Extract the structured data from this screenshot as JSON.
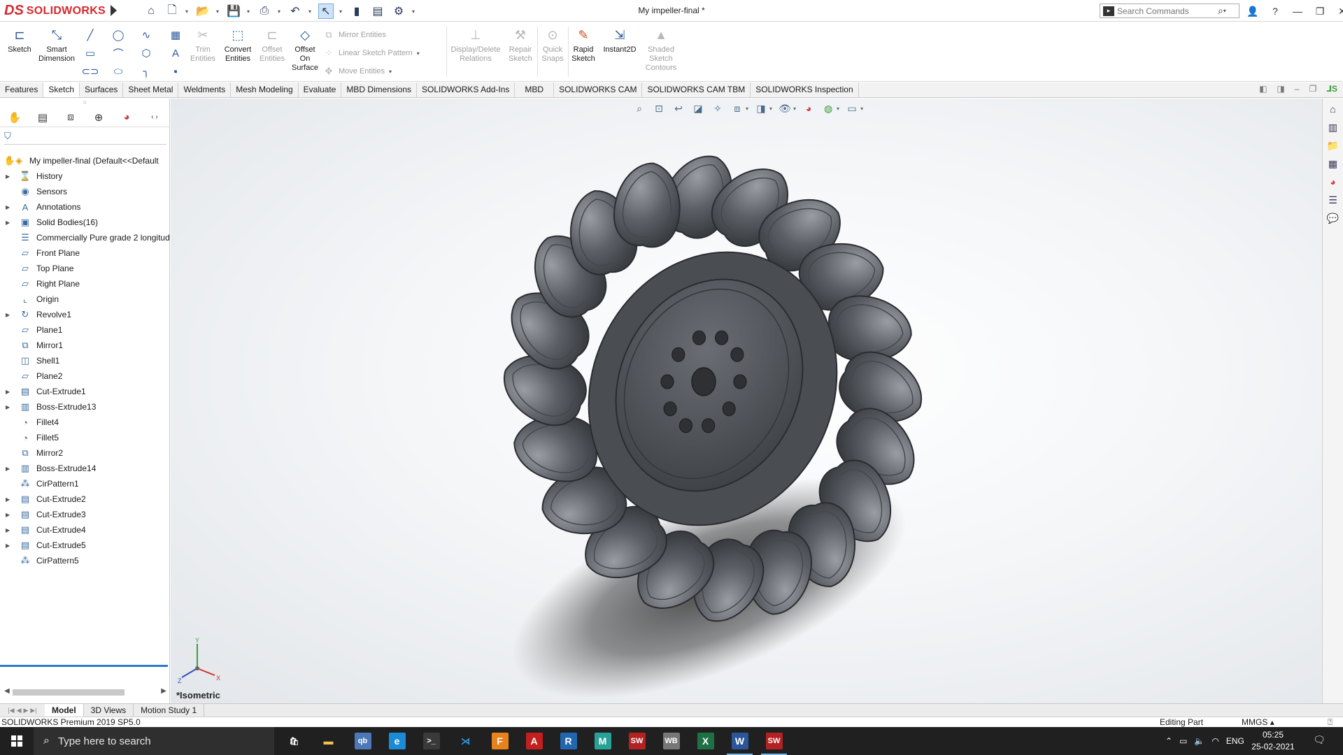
{
  "app": {
    "logo_ds": "DS",
    "logo_text": "SOLIDWORKS",
    "document_title": "My impeller-final *",
    "search_placeholder": "Search Commands"
  },
  "ribbon": {
    "sketch": "Sketch",
    "smart_dimension": "Smart Dimension",
    "trim_entities": "Trim Entities",
    "convert_entities": "Convert Entities",
    "offset_entities": "Offset Entities",
    "offset_on_surface": "Offset On Surface",
    "mirror_entities": "Mirror Entities",
    "linear_sketch_pattern": "Linear Sketch Pattern",
    "move_entities": "Move Entities",
    "display_delete_relations": "Display/Delete Relations",
    "repair_sketch": "Repair Sketch",
    "quick_snaps": "Quick Snaps",
    "rapid_sketch": "Rapid Sketch",
    "instant2d": "Instant2D",
    "shaded_sketch_contours": "Shaded Sketch Contours"
  },
  "tabs": [
    "Features",
    "Sketch",
    "Surfaces",
    "Sheet Metal",
    "Weldments",
    "Mesh Modeling",
    "Evaluate",
    "MBD Dimensions",
    "SOLIDWORKS Add-Ins",
    "MBD",
    "SOLIDWORKS CAM",
    "SOLIDWORKS CAM TBM",
    "SOLIDWORKS Inspection"
  ],
  "active_tab": "Sketch",
  "tree": {
    "root": "My impeller-final  (Default<<Default",
    "items": [
      {
        "label": "History",
        "expand": true,
        "icon": "history-icon",
        "glyph": "⌛"
      },
      {
        "label": "Sensors",
        "expand": false,
        "icon": "sensor-icon",
        "glyph": "◉"
      },
      {
        "label": "Annotations",
        "expand": true,
        "icon": "annotation-icon",
        "glyph": "A"
      },
      {
        "label": "Solid Bodies(16)",
        "expand": true,
        "icon": "solid-body-icon",
        "glyph": "▣"
      },
      {
        "label": "Commercially Pure grade 2 longitud",
        "expand": false,
        "icon": "material-icon",
        "glyph": "☰"
      },
      {
        "label": "Front Plane",
        "expand": false,
        "icon": "plane-icon",
        "glyph": "▱"
      },
      {
        "label": "Top Plane",
        "expand": false,
        "icon": "plane-icon",
        "glyph": "▱"
      },
      {
        "label": "Right Plane",
        "expand": false,
        "icon": "plane-icon",
        "glyph": "▱"
      },
      {
        "label": "Origin",
        "expand": false,
        "icon": "origin-icon",
        "glyph": "⌞"
      },
      {
        "label": "Revolve1",
        "expand": true,
        "icon": "revolve-icon",
        "glyph": "↻"
      },
      {
        "label": "Plane1",
        "expand": false,
        "icon": "plane-icon",
        "glyph": "▱"
      },
      {
        "label": "Mirror1",
        "expand": false,
        "icon": "mirror-icon",
        "glyph": "⧉"
      },
      {
        "label": "Shell1",
        "expand": false,
        "icon": "shell-icon",
        "glyph": "◫"
      },
      {
        "label": "Plane2",
        "expand": false,
        "icon": "plane-icon",
        "glyph": "▱"
      },
      {
        "label": "Cut-Extrude1",
        "expand": true,
        "icon": "cut-extrude-icon",
        "glyph": "▤"
      },
      {
        "label": "Boss-Extrude13",
        "expand": true,
        "icon": "boss-extrude-icon",
        "glyph": "▥"
      },
      {
        "label": "Fillet4",
        "expand": false,
        "icon": "fillet-icon",
        "glyph": "◔"
      },
      {
        "label": "Fillet5",
        "expand": false,
        "icon": "fillet-icon",
        "glyph": "◔"
      },
      {
        "label": "Mirror2",
        "expand": false,
        "icon": "mirror-icon",
        "glyph": "⧉"
      },
      {
        "label": "Boss-Extrude14",
        "expand": true,
        "icon": "boss-extrude-icon",
        "glyph": "▥"
      },
      {
        "label": "CirPattern1",
        "expand": false,
        "icon": "circular-pattern-icon",
        "glyph": "⁂"
      },
      {
        "label": "Cut-Extrude2",
        "expand": true,
        "icon": "cut-extrude-icon",
        "glyph": "▤"
      },
      {
        "label": "Cut-Extrude3",
        "expand": true,
        "icon": "cut-extrude-icon",
        "glyph": "▤"
      },
      {
        "label": "Cut-Extrude4",
        "expand": true,
        "icon": "cut-extrude-icon",
        "glyph": "▤"
      },
      {
        "label": "Cut-Extrude5",
        "expand": true,
        "icon": "cut-extrude-icon",
        "glyph": "▤"
      },
      {
        "label": "CirPattern5",
        "expand": false,
        "icon": "circular-pattern-icon",
        "glyph": "⁂"
      }
    ]
  },
  "viewport": {
    "view_name": "*Isometric",
    "triad": {
      "x": "X",
      "y": "Y",
      "z": "Z"
    }
  },
  "bottom_tabs": [
    "Model",
    "3D Views",
    "Motion Study 1"
  ],
  "active_bottom_tab": "Model",
  "status": {
    "version": "SOLIDWORKS Premium 2019 SP5.0",
    "mode": "Editing Part",
    "units": "MMGS"
  },
  "taskbar": {
    "search_placeholder": "Type here to search",
    "apps": [
      {
        "name": "store",
        "glyph": "🛍",
        "bg": "#202020",
        "fg": "#ffffff"
      },
      {
        "name": "file-explorer",
        "glyph": "▬",
        "bg": "#202020",
        "fg": "#f2c14e"
      },
      {
        "name": "qbittorrent",
        "glyph": "qb",
        "bg": "#4a78b8",
        "fg": "#ffffff"
      },
      {
        "name": "edge",
        "glyph": "e",
        "bg": "#1c8bd6",
        "fg": "#ffffff"
      },
      {
        "name": "terminal",
        "glyph": ">_",
        "bg": "#3a3a3a",
        "fg": "#ffffff"
      },
      {
        "name": "vscode",
        "glyph": "⋊",
        "bg": "#202020",
        "fg": "#2a9ae8"
      },
      {
        "name": "app-f",
        "glyph": "F",
        "bg": "#e8821c",
        "fg": "#ffffff"
      },
      {
        "name": "acrobat",
        "glyph": "A",
        "bg": "#c41e1e",
        "fg": "#ffffff"
      },
      {
        "name": "r-app",
        "glyph": "R",
        "bg": "#2166b0",
        "fg": "#ffffff"
      },
      {
        "name": "m-app",
        "glyph": "M",
        "bg": "#2aa198",
        "fg": "#ffffff"
      },
      {
        "name": "solidworks-2019-a",
        "glyph": "SW",
        "bg": "#b22222",
        "fg": "#ffffff"
      },
      {
        "name": "wb-app",
        "glyph": "WB",
        "bg": "#777777",
        "fg": "#ffffff"
      },
      {
        "name": "excel",
        "glyph": "X",
        "bg": "#1e7145",
        "fg": "#ffffff"
      },
      {
        "name": "word",
        "glyph": "W",
        "bg": "#2b579a",
        "fg": "#ffffff"
      },
      {
        "name": "solidworks-2019-b",
        "glyph": "SW",
        "bg": "#b22222",
        "fg": "#ffffff"
      }
    ],
    "active_apps": [
      "word",
      "solidworks-2019-b"
    ],
    "language": "ENG",
    "time": "05:25",
    "date": "25-02-2021"
  },
  "colors": {
    "accent": "#2a7acd",
    "brand": "#d8282e",
    "model_dark": "#4a4d52",
    "model_light": "#8a8e94"
  }
}
